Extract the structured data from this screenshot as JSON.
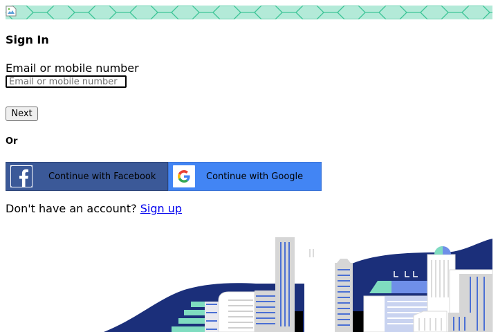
{
  "banner": {
    "alt": ""
  },
  "form": {
    "title": "Sign In",
    "email_label": "Email or mobile number",
    "email_placeholder": "Email or mobile number",
    "email_value": "",
    "next_label": "Next",
    "or_label": "Or"
  },
  "social": {
    "facebook_label": "Continue with Facebook",
    "google_label": "Continue with Google"
  },
  "signup": {
    "prompt": "Don't have an account?",
    "link_label": "Sign up"
  },
  "colors": {
    "banner": "#b3ead8",
    "facebook": "#3b5998",
    "google": "#4285f4",
    "link": "#0000ee",
    "city_navy": "#1b2f7a"
  }
}
